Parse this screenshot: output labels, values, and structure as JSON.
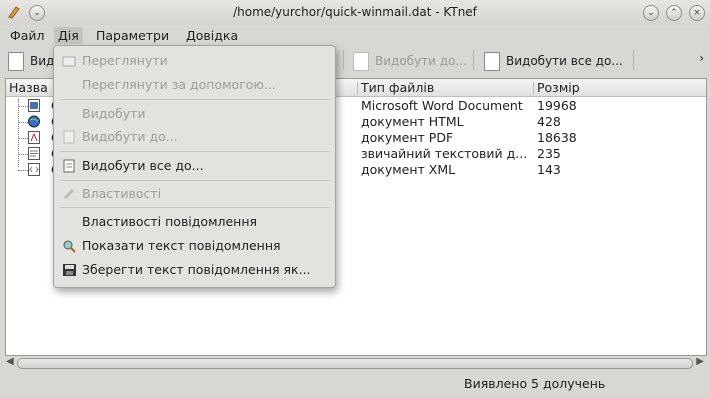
{
  "window": {
    "title": "/home/yurchor/quick-winmail.dat - KTnef"
  },
  "menubar": {
    "file": "Файл",
    "action": "Дія",
    "settings": "Параметри",
    "help": "Довідка"
  },
  "toolbar": {
    "extract_partial": "Видо",
    "extract_to": "Видобути до...",
    "extract_all": "Видобути все до..."
  },
  "list": {
    "headers": {
      "name": "Назва",
      "type": "Тип файлів",
      "size": "Розмір"
    },
    "rows": [
      {
        "name": "С",
        "type": "Microsoft Word Document",
        "size": "19968"
      },
      {
        "name": "С",
        "type": "документ HTML",
        "size": "428"
      },
      {
        "name": "С",
        "type": "документ PDF",
        "size": "18638"
      },
      {
        "name": "С",
        "type": "звичайний текстовий д...",
        "size": "235"
      },
      {
        "name": "С",
        "type": "документ XML",
        "size": "143"
      }
    ]
  },
  "action_menu": {
    "view": "Переглянути",
    "view_with": "Переглянути за допомогою...",
    "extract": "Видобути",
    "extract_to": "Видобути до...",
    "extract_all": "Видобути все до...",
    "properties": "Властивості",
    "message_properties": "Властивості повідомлення",
    "show_message_text": "Показати текст повідомлення",
    "save_message_text": "Зберегти текст повідомлення як..."
  },
  "status": {
    "text": "Виявлено 5 долучень"
  }
}
